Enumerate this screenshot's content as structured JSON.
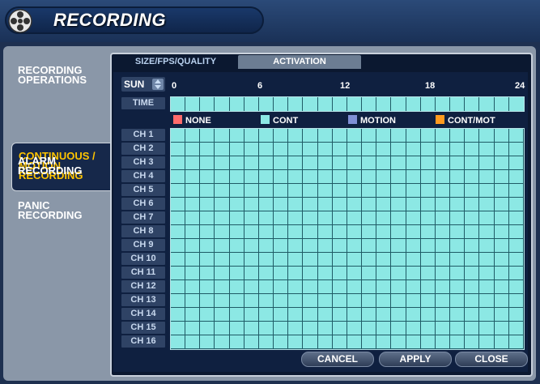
{
  "title": "RECORDING",
  "icons": {
    "title": "film-reel-icon"
  },
  "sidebar": {
    "items": [
      {
        "label_lines": [
          "RECORDING",
          "OPERATIONS"
        ]
      },
      {
        "label_lines": [
          "CONTINUOUS /",
          "MOTION",
          "RECORDING"
        ],
        "active": true
      },
      {
        "label_lines": [
          "ALARM",
          "RECORDING"
        ]
      },
      {
        "label_lines": [
          "PANIC",
          "RECORDING"
        ]
      }
    ]
  },
  "tabs": [
    {
      "label": "SIZE/FPS/QUALITY",
      "active": false
    },
    {
      "label": "ACTIVATION",
      "active": true
    }
  ],
  "day": "SUN",
  "hours": [
    "0",
    "6",
    "12",
    "18",
    "24"
  ],
  "time_label": "TIME",
  "legend": [
    {
      "label": "NONE",
      "color": "#ff6b6b"
    },
    {
      "label": "CONT",
      "color": "#8ce8e4"
    },
    {
      "label": "MOTION",
      "color": "#7f8fd6"
    },
    {
      "label": "CONT/MOT",
      "color": "#ff9a1f"
    }
  ],
  "channels": [
    "CH 1",
    "CH 2",
    "CH 3",
    "CH 4",
    "CH 5",
    "CH 6",
    "CH 7",
    "CH 8",
    "CH 9",
    "CH 10",
    "CH 11",
    "CH 12",
    "CH 13",
    "CH 14",
    "CH 15",
    "CH 16"
  ],
  "grid_mode": "CONT",
  "buttons": {
    "cancel": "CANCEL",
    "apply": "APPLY",
    "close": "CLOSE"
  },
  "colors": {
    "active_menu": "#ffc400",
    "cell": "#8ce8e4"
  }
}
